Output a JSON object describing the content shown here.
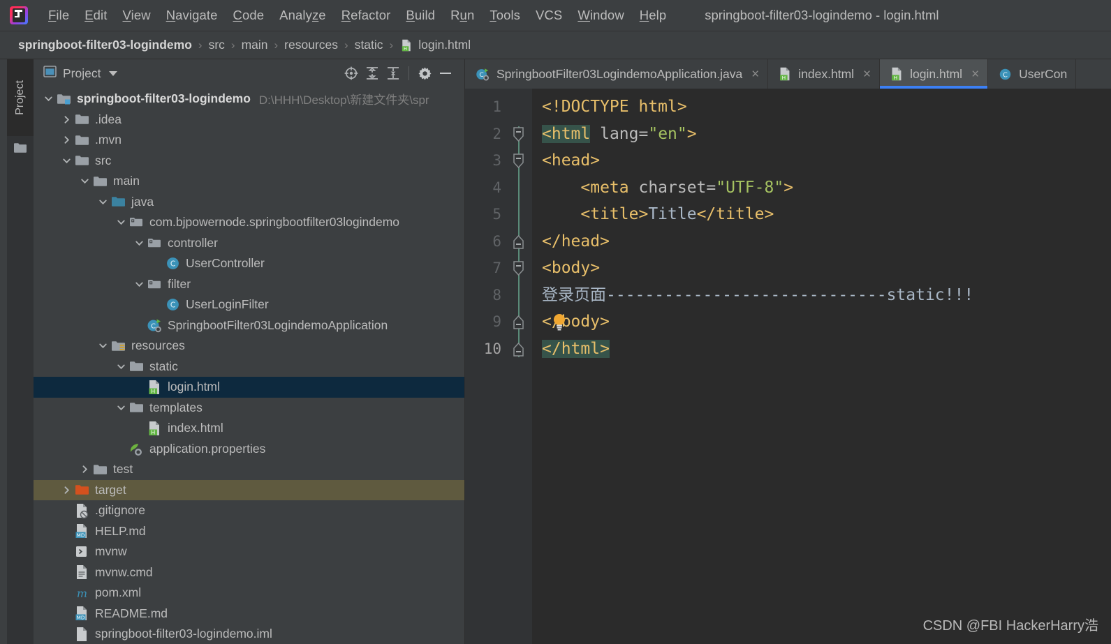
{
  "window": {
    "title": "springboot-filter03-logindemo - login.html",
    "logo_icon": "intellij-idea-logo"
  },
  "menubar": {
    "items": [
      {
        "label": "File",
        "mnemonic": "F"
      },
      {
        "label": "Edit",
        "mnemonic": "E"
      },
      {
        "label": "View",
        "mnemonic": "V"
      },
      {
        "label": "Navigate",
        "mnemonic": "N"
      },
      {
        "label": "Code",
        "mnemonic": "C"
      },
      {
        "label": "Analyze",
        "mnemonic": "z"
      },
      {
        "label": "Refactor",
        "mnemonic": "R"
      },
      {
        "label": "Build",
        "mnemonic": "B"
      },
      {
        "label": "Run",
        "mnemonic": "u"
      },
      {
        "label": "Tools",
        "mnemonic": "T"
      },
      {
        "label": "VCS",
        "mnemonic": ""
      },
      {
        "label": "Window",
        "mnemonic": "W"
      },
      {
        "label": "Help",
        "mnemonic": "H"
      }
    ]
  },
  "breadcrumb": {
    "separator": "›",
    "items": [
      {
        "label": "springboot-filter03-logindemo",
        "bold": true,
        "icon": ""
      },
      {
        "label": "src",
        "bold": false,
        "icon": ""
      },
      {
        "label": "main",
        "bold": false,
        "icon": ""
      },
      {
        "label": "resources",
        "bold": false,
        "icon": ""
      },
      {
        "label": "static",
        "bold": false,
        "icon": ""
      },
      {
        "label": "login.html",
        "bold": false,
        "icon": "html-file-icon"
      }
    ]
  },
  "tool_strip": {
    "vertical_tab_label": "Project",
    "vertical_tab_icon": "folder-icon"
  },
  "project_panel": {
    "title": "Project",
    "view_icon": "project-view-icon",
    "dropdown_icon": "chevron-down-icon",
    "actions": [
      {
        "name": "locate-icon",
        "tooltip": "Select Opened File"
      },
      {
        "name": "expand-all-icon",
        "tooltip": "Expand All"
      },
      {
        "name": "collapse-all-icon",
        "tooltip": "Collapse All"
      },
      {
        "name": "gear-icon",
        "tooltip": "Settings"
      },
      {
        "name": "minimize-icon",
        "tooltip": "Hide"
      }
    ],
    "tree": [
      {
        "indent": 0,
        "arrow": "down",
        "icon": "module-folder-icon",
        "label": "springboot-filter03-logindemo",
        "bold": true,
        "path": "D:\\HHH\\Desktop\\新建文件夹\\spr",
        "state": "normal"
      },
      {
        "indent": 1,
        "arrow": "right",
        "icon": "folder-icon",
        "label": ".idea",
        "bold": false,
        "path": "",
        "state": "normal"
      },
      {
        "indent": 1,
        "arrow": "right",
        "icon": "folder-icon",
        "label": ".mvn",
        "bold": false,
        "path": "",
        "state": "normal"
      },
      {
        "indent": 1,
        "arrow": "down",
        "icon": "folder-icon",
        "label": "src",
        "bold": false,
        "path": "",
        "state": "normal"
      },
      {
        "indent": 2,
        "arrow": "down",
        "icon": "folder-icon",
        "label": "main",
        "bold": false,
        "path": "",
        "state": "normal"
      },
      {
        "indent": 3,
        "arrow": "down",
        "icon": "source-root-folder-icon",
        "label": "java",
        "bold": false,
        "path": "",
        "state": "normal"
      },
      {
        "indent": 4,
        "arrow": "down",
        "icon": "package-icon",
        "label": "com.bjpowernode.springbootfilter03logindemo",
        "bold": false,
        "path": "",
        "state": "normal"
      },
      {
        "indent": 5,
        "arrow": "down",
        "icon": "package-icon",
        "label": "controller",
        "bold": false,
        "path": "",
        "state": "normal"
      },
      {
        "indent": 6,
        "arrow": "none",
        "icon": "java-class-icon",
        "label": "UserController",
        "bold": false,
        "path": "",
        "state": "normal"
      },
      {
        "indent": 5,
        "arrow": "down",
        "icon": "package-icon",
        "label": "filter",
        "bold": false,
        "path": "",
        "state": "normal"
      },
      {
        "indent": 6,
        "arrow": "none",
        "icon": "java-class-icon",
        "label": "UserLoginFilter",
        "bold": false,
        "path": "",
        "state": "normal"
      },
      {
        "indent": 5,
        "arrow": "none",
        "icon": "spring-boot-app-icon",
        "label": "SpringbootFilter03LogindemoApplication",
        "bold": false,
        "path": "",
        "state": "normal"
      },
      {
        "indent": 3,
        "arrow": "down",
        "icon": "resource-root-folder-icon",
        "label": "resources",
        "bold": false,
        "path": "",
        "state": "normal"
      },
      {
        "indent": 4,
        "arrow": "down",
        "icon": "folder-icon",
        "label": "static",
        "bold": false,
        "path": "",
        "state": "normal"
      },
      {
        "indent": 5,
        "arrow": "none",
        "icon": "html-file-icon",
        "label": "login.html",
        "bold": false,
        "path": "",
        "state": "selected"
      },
      {
        "indent": 4,
        "arrow": "down",
        "icon": "folder-icon",
        "label": "templates",
        "bold": false,
        "path": "",
        "state": "normal"
      },
      {
        "indent": 5,
        "arrow": "none",
        "icon": "html-file-icon",
        "label": "index.html",
        "bold": false,
        "path": "",
        "state": "normal"
      },
      {
        "indent": 4,
        "arrow": "none",
        "icon": "spring-properties-icon",
        "label": "application.properties",
        "bold": false,
        "path": "",
        "state": "normal"
      },
      {
        "indent": 2,
        "arrow": "right",
        "icon": "folder-icon",
        "label": "test",
        "bold": false,
        "path": "",
        "state": "normal"
      },
      {
        "indent": 1,
        "arrow": "right",
        "icon": "excluded-folder-icon",
        "label": "target",
        "bold": false,
        "path": "",
        "state": "hovered"
      },
      {
        "indent": 1,
        "arrow": "none",
        "icon": "gitignore-file-icon",
        "label": ".gitignore",
        "bold": false,
        "path": "",
        "state": "normal"
      },
      {
        "indent": 1,
        "arrow": "none",
        "icon": "markdown-file-icon",
        "label": "HELP.md",
        "bold": false,
        "path": "",
        "state": "normal"
      },
      {
        "indent": 1,
        "arrow": "none",
        "icon": "shell-script-icon",
        "label": "mvnw",
        "bold": false,
        "path": "",
        "state": "normal"
      },
      {
        "indent": 1,
        "arrow": "none",
        "icon": "cmd-file-icon",
        "label": "mvnw.cmd",
        "bold": false,
        "path": "",
        "state": "normal"
      },
      {
        "indent": 1,
        "arrow": "none",
        "icon": "maven-pom-icon",
        "label": "pom.xml",
        "bold": false,
        "path": "",
        "state": "normal"
      },
      {
        "indent": 1,
        "arrow": "none",
        "icon": "markdown-file-icon",
        "label": "README.md",
        "bold": false,
        "path": "",
        "state": "normal"
      },
      {
        "indent": 1,
        "arrow": "none",
        "icon": "iml-file-icon",
        "label": "springboot-filter03-logindemo.iml",
        "bold": false,
        "path": "",
        "state": "normal"
      }
    ]
  },
  "editor": {
    "tabs": [
      {
        "label": "SpringbootFilter03LogindemoApplication.java",
        "icon": "spring-boot-app-icon",
        "active": false,
        "close_icon": "×"
      },
      {
        "label": "index.html",
        "icon": "html-file-icon",
        "active": false,
        "close_icon": "×"
      },
      {
        "label": "login.html",
        "icon": "html-file-icon",
        "active": true,
        "close_icon": "×"
      },
      {
        "label": "UserCon",
        "icon": "java-class-icon",
        "active": false,
        "close_icon": ""
      }
    ],
    "current_line": 10,
    "line_numbers": [
      1,
      2,
      3,
      4,
      5,
      6,
      7,
      8,
      9,
      10
    ],
    "intention_bulb_icon": "lightbulb-icon",
    "code_lines": [
      {
        "n": 1,
        "segments": [
          {
            "t": "<!DOCTYPE html>",
            "c": "tag"
          }
        ]
      },
      {
        "n": 2,
        "segments": [
          {
            "t": "<html",
            "c": "tag hl"
          },
          {
            "t": " lang=",
            "c": "attr"
          },
          {
            "t": "\"en\"",
            "c": "val"
          },
          {
            "t": ">",
            "c": "tag"
          }
        ]
      },
      {
        "n": 3,
        "segments": [
          {
            "t": "<head>",
            "c": "tag"
          }
        ]
      },
      {
        "n": 4,
        "segments": [
          {
            "t": "    <meta",
            "c": "tag"
          },
          {
            "t": " charset=",
            "c": "attr"
          },
          {
            "t": "\"UTF-8\"",
            "c": "val"
          },
          {
            "t": ">",
            "c": "tag"
          }
        ]
      },
      {
        "n": 5,
        "segments": [
          {
            "t": "    <title>",
            "c": "tag"
          },
          {
            "t": "Title",
            "c": "txt"
          },
          {
            "t": "</title>",
            "c": "tag"
          }
        ]
      },
      {
        "n": 6,
        "segments": [
          {
            "t": "</head>",
            "c": "tag"
          }
        ]
      },
      {
        "n": 7,
        "segments": [
          {
            "t": "<body>",
            "c": "tag"
          }
        ]
      },
      {
        "n": 8,
        "segments": [
          {
            "t": "登录页面-----------------------------static!!!",
            "c": "txt"
          }
        ]
      },
      {
        "n": 9,
        "segments": [
          {
            "t": "</body>",
            "c": "tag"
          }
        ]
      },
      {
        "n": 10,
        "segments": [
          {
            "t": "</html>",
            "c": "tag hl"
          }
        ]
      }
    ],
    "fold_markers": [
      2,
      3,
      6,
      7,
      9,
      10
    ]
  },
  "watermark": {
    "text": "CSDN @FBI HackerHarry浩"
  },
  "colors": {
    "window_bg": "#3c3f41",
    "editor_bg": "#2b2b2b",
    "gutter_bg": "#313335",
    "selection_blue": "#0d293e",
    "hover_olive": "#5f5a3f",
    "active_tab_underline": "#3c80f5",
    "tag_orange": "#e8bf6a",
    "string_green": "#a5c261",
    "text_grey": "#a9b7c6",
    "match_highlight": "#36534a"
  }
}
